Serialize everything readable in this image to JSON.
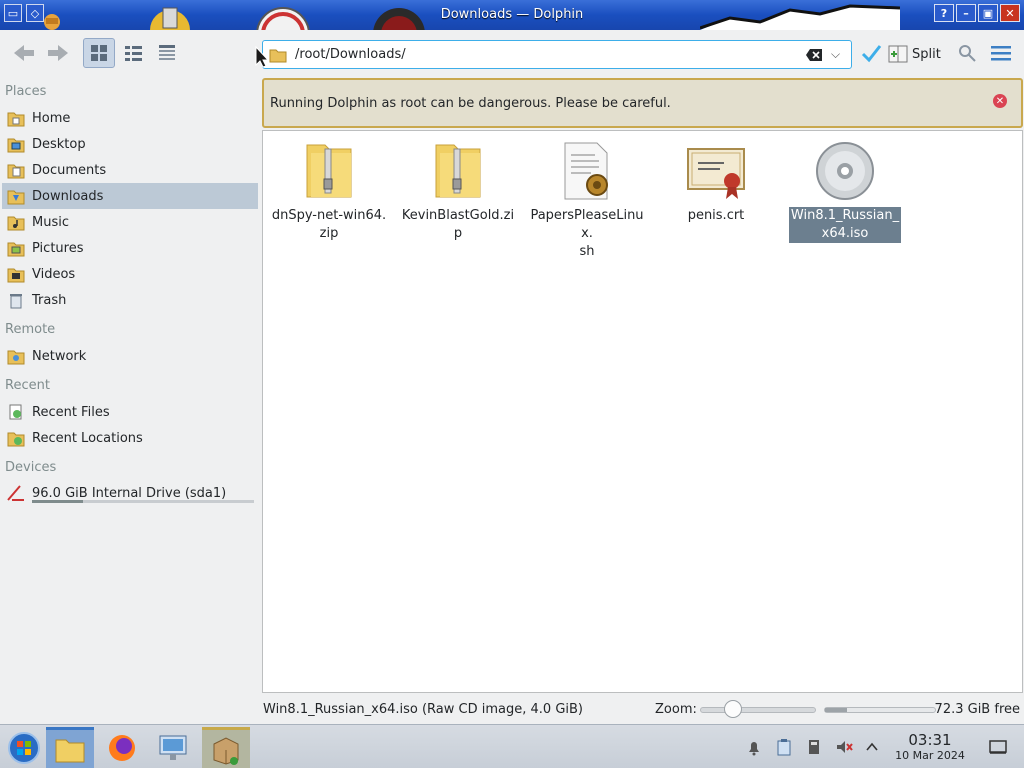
{
  "window": {
    "title": "Downloads — Dolphin"
  },
  "toolbar": {
    "location": "/root/Downloads/",
    "split_label": "Split"
  },
  "sidebar": {
    "sections": {
      "places": "Places",
      "remote": "Remote",
      "recent": "Recent",
      "devices": "Devices"
    },
    "places": [
      {
        "label": "Home",
        "icon": "home-folder-icon"
      },
      {
        "label": "Desktop",
        "icon": "desktop-folder-icon"
      },
      {
        "label": "Documents",
        "icon": "documents-folder-icon"
      },
      {
        "label": "Downloads",
        "icon": "downloads-folder-icon",
        "selected": true
      },
      {
        "label": "Music",
        "icon": "music-folder-icon"
      },
      {
        "label": "Pictures",
        "icon": "pictures-folder-icon"
      },
      {
        "label": "Videos",
        "icon": "videos-folder-icon"
      },
      {
        "label": "Trash",
        "icon": "trash-icon"
      }
    ],
    "remote": [
      {
        "label": "Network",
        "icon": "network-folder-icon"
      }
    ],
    "recent": [
      {
        "label": "Recent Files",
        "icon": "recent-files-icon"
      },
      {
        "label": "Recent Locations",
        "icon": "recent-locations-icon"
      }
    ],
    "devices": [
      {
        "label": "96.0 GiB Internal Drive (sda1)",
        "icon": "drive-icon",
        "usage_fraction": 0.23
      }
    ]
  },
  "warning": {
    "message": "Running Dolphin as root can be dangerous. Please be careful."
  },
  "files": [
    {
      "name": "dnSpy-net-win64.zip",
      "line1": "dnSpy-net-win64.",
      "line2": "zip",
      "icon": "zip-archive-icon"
    },
    {
      "name": "KevinBlastGold.zip",
      "line1": "KevinBlastGold.zip",
      "line2": "",
      "icon": "zip-archive-icon"
    },
    {
      "name": "PapersPleaseLinux.sh",
      "line1": "PapersPleaseLinux.",
      "line2": "sh",
      "icon": "shell-script-icon"
    },
    {
      "name": "penis.crt",
      "line1": "penis.crt",
      "line2": "",
      "icon": "certificate-icon"
    },
    {
      "name": "Win8.1_Russian_x64.iso",
      "line1": "Win8.1_Russian_",
      "line2": "x64.iso",
      "icon": "cd-image-icon",
      "selected": true
    }
  ],
  "status": {
    "info": "Win8.1_Russian_x64.iso (Raw CD image, 4.0 GiB)",
    "zoom_label": "Zoom:",
    "free_label": "72.3 GiB free",
    "free_used_fraction": 0.2
  },
  "taskbar": {
    "time": "03:31",
    "date": "10 Mar 2024"
  },
  "colors": {
    "accent": "#3daee9",
    "selection": "#bcc9d6",
    "warning_border": "#c9a84e",
    "warning_bg": "#e3dfce",
    "titlebar": "#1a4fbf"
  }
}
